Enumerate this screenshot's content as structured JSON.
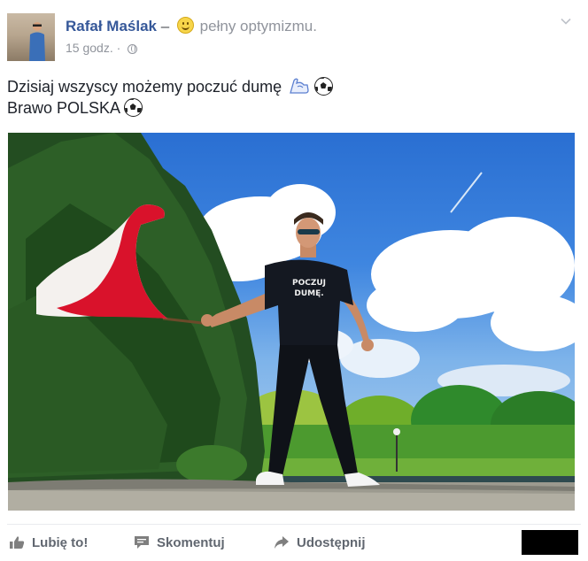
{
  "post": {
    "author_name": "Rafał Maślak",
    "separator": "–",
    "feeling_text": "pełny optymizmu.",
    "feeling_icon": "smiling-emoji-icon",
    "timestamp": "15 godz.",
    "dot": "·",
    "privacy_icon": "globe-icon",
    "menu_icon": "chevron-down-icon",
    "text_line_1": "Dzisiaj wszyscy możemy poczuć dumę",
    "text_line_1_icons": [
      "flexed-biceps-icon",
      "soccer-ball-icon"
    ],
    "text_line_2": "Brawo POLSKA",
    "text_line_2_icons": [
      "soccer-ball-icon"
    ],
    "photo": {
      "description_icon": "photo",
      "shirt_text_1": "POCZUJ",
      "shirt_text_2": "DUMĘ."
    }
  },
  "actions": {
    "like_label": "Lubię to!",
    "comment_label": "Skomentuj",
    "share_label": "Udostępnij",
    "like_icon": "thumbs-up-icon",
    "comment_icon": "speech-bubble-icon",
    "share_icon": "share-arrow-icon"
  },
  "colors": {
    "author_link": "#365899",
    "secondary_text": "#90949c",
    "action_text": "#616770",
    "flag_white": "#f4f1ee",
    "flag_red": "#d9122b"
  }
}
